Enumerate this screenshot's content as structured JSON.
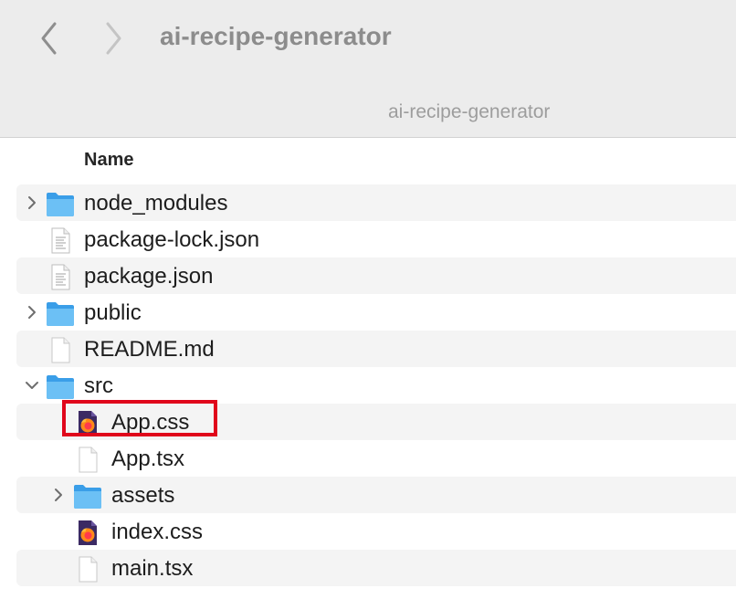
{
  "window": {
    "title": "ai-recipe-generator"
  },
  "toolbar": {
    "path_label": "ai-recipe-generator",
    "back_icon": "chevron-left-icon",
    "forward_icon": "chevron-right-icon"
  },
  "list": {
    "column_header": "Name",
    "items": [
      {
        "name": "node_modules",
        "type": "folder",
        "depth": 0,
        "expandable": true,
        "expanded": false
      },
      {
        "name": "package-lock.json",
        "type": "json",
        "depth": 0
      },
      {
        "name": "package.json",
        "type": "json",
        "depth": 0
      },
      {
        "name": "public",
        "type": "folder",
        "depth": 0,
        "expandable": true,
        "expanded": false
      },
      {
        "name": "README.md",
        "type": "doc",
        "depth": 0
      },
      {
        "name": "src",
        "type": "folder",
        "depth": 0,
        "expandable": true,
        "expanded": true
      },
      {
        "name": "App.css",
        "type": "css",
        "depth": 1
      },
      {
        "name": "App.tsx",
        "type": "doc",
        "depth": 1
      },
      {
        "name": "assets",
        "type": "folder",
        "depth": 1,
        "expandable": true,
        "expanded": false
      },
      {
        "name": "index.css",
        "type": "css",
        "depth": 1
      },
      {
        "name": "main.tsx",
        "type": "doc",
        "depth": 1
      }
    ]
  },
  "annotation": {
    "highlighted_item": "App.css",
    "color": "#e0061b"
  }
}
